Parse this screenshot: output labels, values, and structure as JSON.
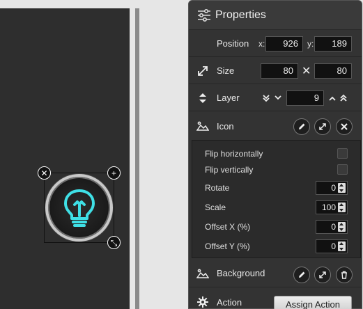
{
  "panel": {
    "title": "Properties",
    "position": {
      "label": "Position",
      "x_label": "x:",
      "x": "926",
      "y_label": "y:",
      "y": "189"
    },
    "size": {
      "label": "Size",
      "width": "80",
      "height": "80",
      "separator": "✕"
    },
    "layer": {
      "label": "Layer",
      "value": "9"
    },
    "icon": {
      "label": "Icon"
    },
    "options": {
      "flip_h": "Flip horizontally",
      "flip_v": "Flip vertically",
      "rotate_label": "Rotate",
      "rotate": "0",
      "scale_label": "Scale",
      "scale": "100",
      "offset_x_label": "Offset X (%)",
      "offset_x": "0",
      "offset_y_label": "Offset Y (%)",
      "offset_y": "0"
    },
    "background": {
      "label": "Background"
    },
    "action": {
      "label": "Action",
      "button": "Assign Action"
    }
  },
  "canvas": {
    "handles": {
      "close": "✕",
      "add": "+",
      "resize": "⤡"
    },
    "icon_name": "lightbulb-icon",
    "glow_color": "#3fe0e6"
  }
}
